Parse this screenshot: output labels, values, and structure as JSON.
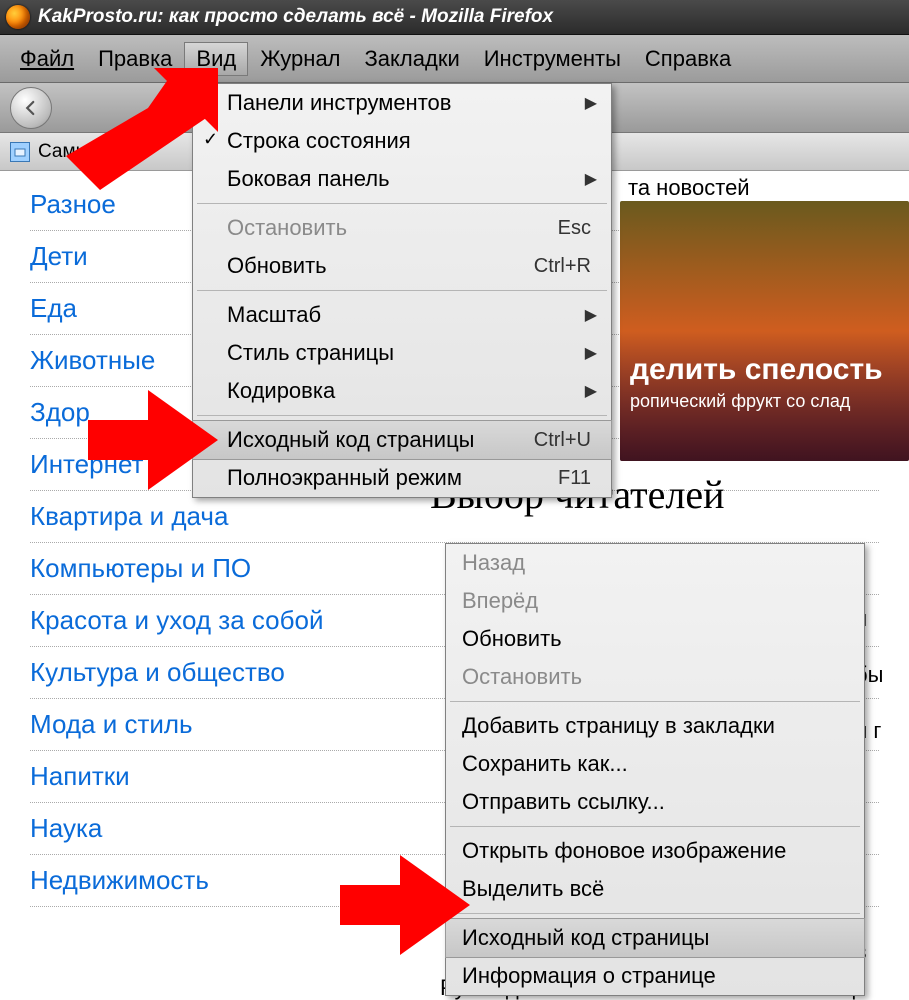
{
  "titlebar": {
    "text": "KakProsto.ru: как просто сделать всё - Mozilla Firefox"
  },
  "menubar": {
    "file": "Файл",
    "edit": "Правка",
    "view": "Вид",
    "journal": "Журнал",
    "bookmarks": "Закладки",
    "tools": "Инструменты",
    "help": "Справка"
  },
  "bookmarks_bar": {
    "popular_partial": "Самые п   ул"
  },
  "news_label": "та новостей",
  "categories": [
    "Разное",
    "Дети",
    "Еда",
    "Животные",
    "Здор",
    "Интернет",
    "Квартира и дача",
    "Компьютеры и ПО",
    "Красота и уход за собой",
    "Культура и общество",
    "Мода и стиль",
    "Напитки",
    "Наука",
    "Недвижимость"
  ],
  "hero": {
    "title_partial": "делить спелость",
    "subtitle_partial": "ропический фрукт со слад"
  },
  "choice_heading": "Выбор читателей",
  "right_text_fragments": [
    "н",
    "бы",
    "и г",
    "в"
  ],
  "bottom_text_fragment": "Рукав для запекания изготовлен из спец",
  "view_menu": {
    "toolbars": "Панели инструментов",
    "status_bar": "Строка состояния",
    "sidebar": "Боковая панель",
    "stop": "Остановить",
    "stop_shortcut": "Esc",
    "reload": "Обновить",
    "reload_shortcut": "Ctrl+R",
    "zoom": "Масштаб",
    "page_style": "Стиль страницы",
    "encoding": "Кодировка",
    "source": "Исходный код страницы",
    "source_shortcut": "Ctrl+U",
    "fullscreen": "Полноэкранный режим",
    "fullscreen_shortcut": "F11"
  },
  "context_menu": {
    "back": "Назад",
    "forward": "Вперёд",
    "reload": "Обновить",
    "stop": "Остановить",
    "add_bookmark": "Добавить страницу в закладки",
    "save_as": "Сохранить как...",
    "send_link": "Отправить ссылку...",
    "open_bg_image": "Открыть фоновое изображение",
    "select_all": "Выделить всё",
    "source": "Исходный код страницы",
    "page_info": "Информация о странице"
  }
}
